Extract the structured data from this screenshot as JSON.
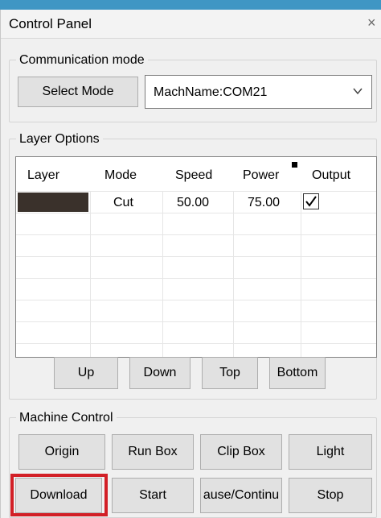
{
  "window": {
    "title": "Control Panel",
    "close_glyph": "×"
  },
  "communication": {
    "group_label": "Communication mode",
    "select_mode_label": "Select Mode",
    "machine_value": "MachName:COM21"
  },
  "layer_options": {
    "group_label": "Layer Options",
    "columns": {
      "layer": "Layer",
      "mode": "Mode",
      "speed": "Speed",
      "power": "Power",
      "output": "Output"
    },
    "rows": [
      {
        "color": "#3a312b",
        "mode": "Cut",
        "speed": "50.00",
        "power": "75.00",
        "output_checked": true
      }
    ],
    "buttons": {
      "up": "Up",
      "down": "Down",
      "top": "Top",
      "bottom": "Bottom"
    }
  },
  "machine_control": {
    "group_label": "Machine Control",
    "buttons": {
      "origin": "Origin",
      "run_box": "Run Box",
      "clip_box": "Clip Box",
      "light": "Light",
      "download": "Download",
      "start": "Start",
      "pause_continue": "ause/Continu",
      "stop": "Stop"
    }
  },
  "colors": {
    "highlight": "#d21f26",
    "titlebar_accent": "#3f96c4"
  },
  "icons": {
    "close": "close-icon",
    "dropdown": "chevron-down-icon",
    "checkbox": "checkmark-icon"
  }
}
